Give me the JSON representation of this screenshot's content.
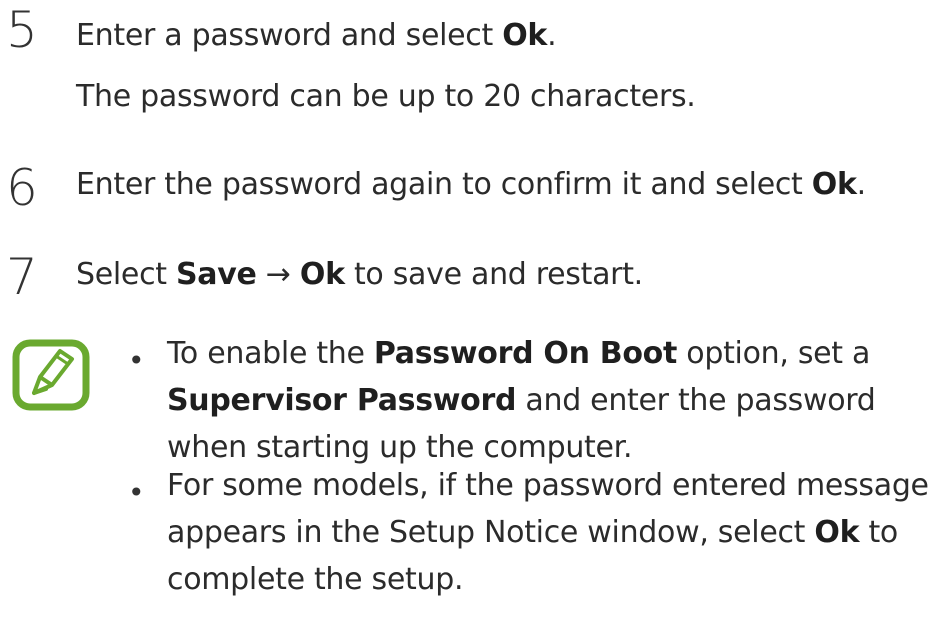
{
  "steps": [
    {
      "number": "5",
      "parts": [
        "Enter a password and select ",
        "Ok",
        "."
      ],
      "note": "The password can be up to 20 characters."
    },
    {
      "number": "6",
      "parts": [
        "Enter the password again to confirm it and select ",
        "Ok",
        "."
      ]
    },
    {
      "number": "7",
      "parts": [
        "Select ",
        "Save",
        " → ",
        "Ok",
        " to save and restart."
      ]
    }
  ],
  "notes": {
    "icon": "note-pencil-icon",
    "accent_color": "#6aa92f",
    "items": [
      {
        "bullet": "•",
        "parts": [
          "To enable the ",
          "Password On Boot",
          " option, set a ",
          "Supervisor Password",
          " and enter the password when starting up the computer."
        ]
      },
      {
        "bullet": "•",
        "parts": [
          "For some models, if the password entered message appears in the Setup Notice window, select ",
          "Ok",
          " to complete the setup."
        ]
      }
    ]
  }
}
